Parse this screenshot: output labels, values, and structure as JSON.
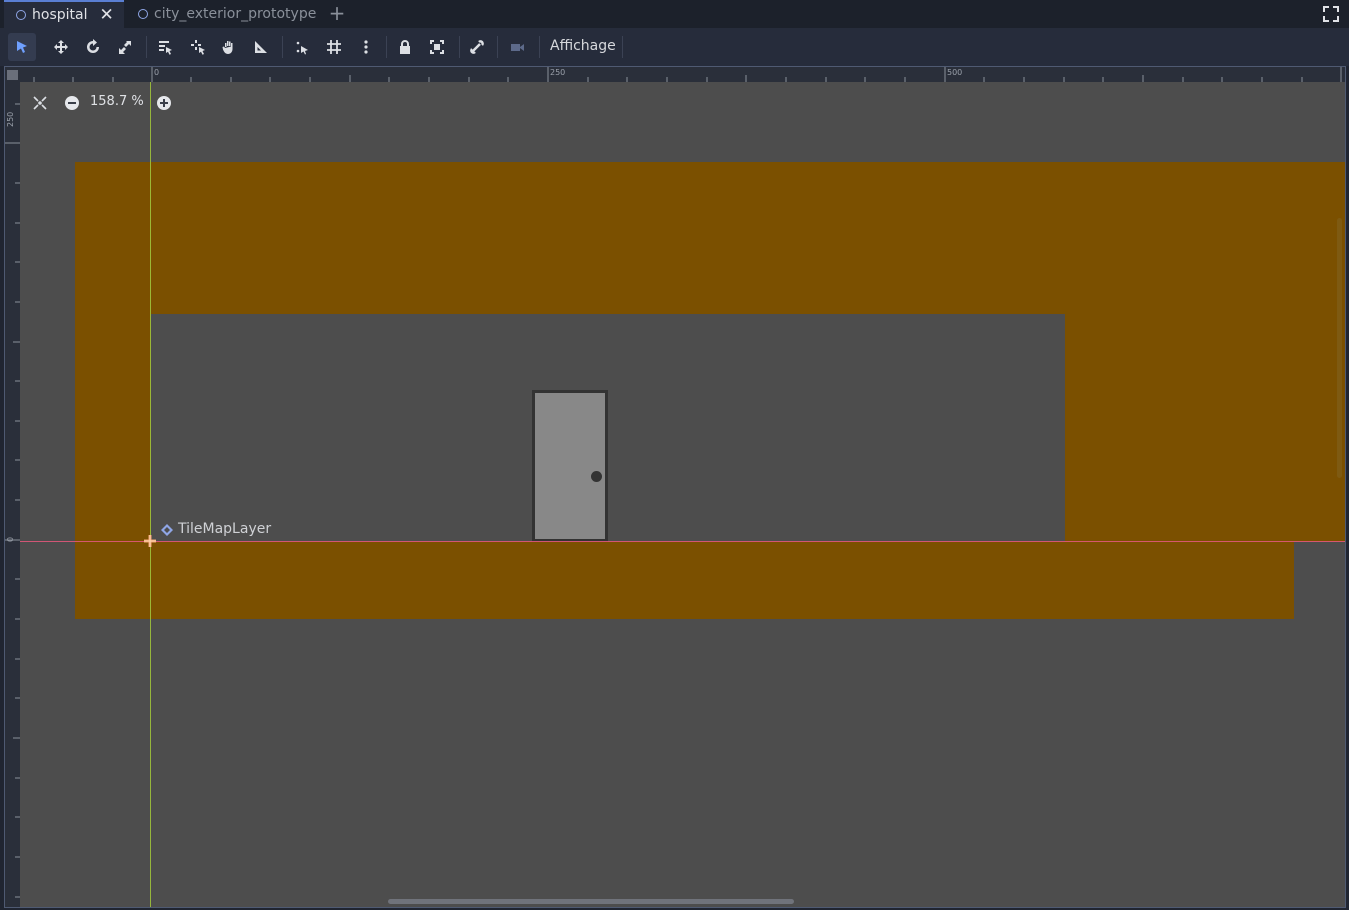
{
  "tabs": [
    {
      "label": "hospital",
      "active": true
    },
    {
      "label": "city_exterior_prototype",
      "active": false
    }
  ],
  "toolbar": {
    "view_menu_label": "Affichage",
    "tools": [
      "select-icon",
      "move-icon",
      "rotate-icon",
      "scale-icon",
      "list-select-icon",
      "pivot-icon",
      "pan-hand-icon",
      "ruler-icon",
      "smart-snap-icon",
      "grid-snap-icon",
      "more-options-icon",
      "lock-icon",
      "group-icon",
      "bone-icon",
      "camera-override-icon"
    ]
  },
  "viewport": {
    "zoom_label": "158.7 %",
    "ruler_top_labels": [
      "0",
      "250",
      "500"
    ],
    "ruler_left_labels": [
      "250",
      "0"
    ],
    "node_label": "TileMapLayer"
  },
  "colors": {
    "accent": "#5a7fd3",
    "wall": "#7b5000",
    "background": "#4d4d4d",
    "door": "#888888",
    "axis_x": "#e0587a",
    "axis_y": "#9fc23b"
  }
}
